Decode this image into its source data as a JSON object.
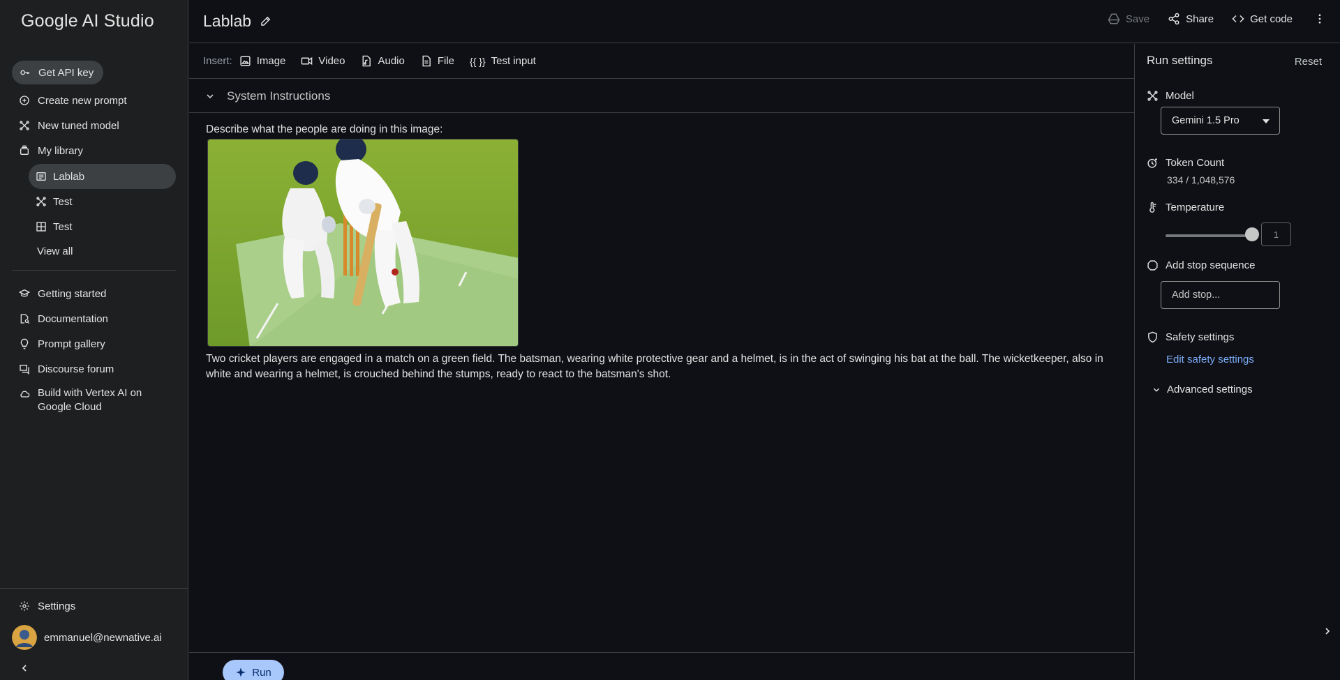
{
  "sidebar": {
    "brand": "Google AI Studio",
    "get_api_key": "Get API key",
    "create_prompt": "Create new prompt",
    "new_tuned_model": "New tuned model",
    "my_library": "My library",
    "library_items": [
      {
        "label": "Lablab",
        "icon": "chat-prompt-icon"
      },
      {
        "label": "Test",
        "icon": "tuned-model-icon"
      },
      {
        "label": "Test",
        "icon": "structured-prompt-icon"
      }
    ],
    "view_all": "View all",
    "getting_started": "Getting started",
    "documentation": "Documentation",
    "prompt_gallery": "Prompt gallery",
    "discourse_forum": "Discourse forum",
    "vertex": "Build with Vertex AI on Google Cloud",
    "settings": "Settings",
    "user_email": "emmanuel@newnative.ai"
  },
  "header": {
    "title": "Lablab",
    "save": "Save",
    "share": "Share",
    "get_code": "Get code"
  },
  "insert": {
    "label": "Insert:",
    "image": "Image",
    "video": "Video",
    "audio": "Audio",
    "file": "File",
    "test_input_braces": "{{ }}",
    "test_input": "Test input"
  },
  "system_instructions": "System Instructions",
  "prompt": {
    "text": "Describe what the people are doing in this image:",
    "response": "Two cricket players are engaged in a match on a green field. The batsman, wearing white protective gear and a helmet, is in the act of swinging his bat at the ball. The wicketkeeper, also in white and wearing a helmet, is crouched behind the stumps, ready to react to the batsman's shot."
  },
  "run": "Run",
  "run_settings": {
    "title": "Run settings",
    "reset": "Reset",
    "model_label": "Model",
    "model_value": "Gemini 1.5 Pro",
    "token_label": "Token Count",
    "token_value": "334 / 1,048,576",
    "temperature_label": "Temperature",
    "temperature_value": "1",
    "temperature_fraction": 1.0,
    "stop_label": "Add stop sequence",
    "stop_placeholder": "Add stop...",
    "safety_label": "Safety settings",
    "edit_safety": "Edit safety settings",
    "advanced": "Advanced settings"
  },
  "colors": {
    "accent_link": "#7cacf8",
    "run_button": "#a8c7fa",
    "background": "#0e1015",
    "sidebar": "#1e1f20"
  }
}
